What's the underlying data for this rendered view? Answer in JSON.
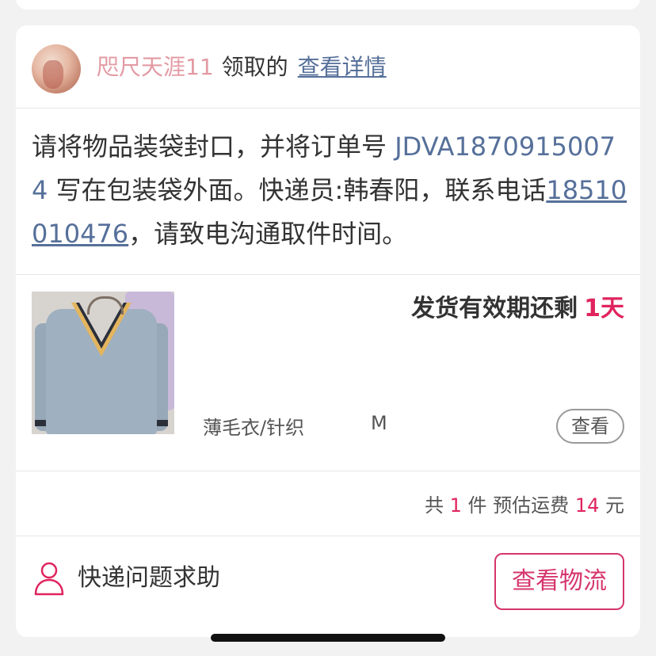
{
  "header": {
    "username": "咫尺天涯11",
    "claim_text": "领取的",
    "detail_link": "查看详情"
  },
  "instructions": {
    "part1": "请将物品装袋封口，并将订单号 ",
    "order_number": "JDVA18709150074",
    "part2": " 写在包装袋外面。快递员:韩春阳，联系电话",
    "phone": "18510010476",
    "part3": "，请致电沟通取件时间。"
  },
  "item": {
    "expire_label": "发货有效期还剩",
    "expire_value": "1天",
    "category": "薄毛衣/针织",
    "size": "M",
    "view_button": "查看"
  },
  "summary": {
    "prefix": "共",
    "count": "1",
    "middle": "件 预估运费",
    "fee": "14",
    "suffix": "元"
  },
  "footer": {
    "help_text": "快递问题求助",
    "logistics_button": "查看物流"
  },
  "colors": {
    "accent": "#e0245e",
    "link": "#56709a",
    "username": "#e39aa3"
  }
}
